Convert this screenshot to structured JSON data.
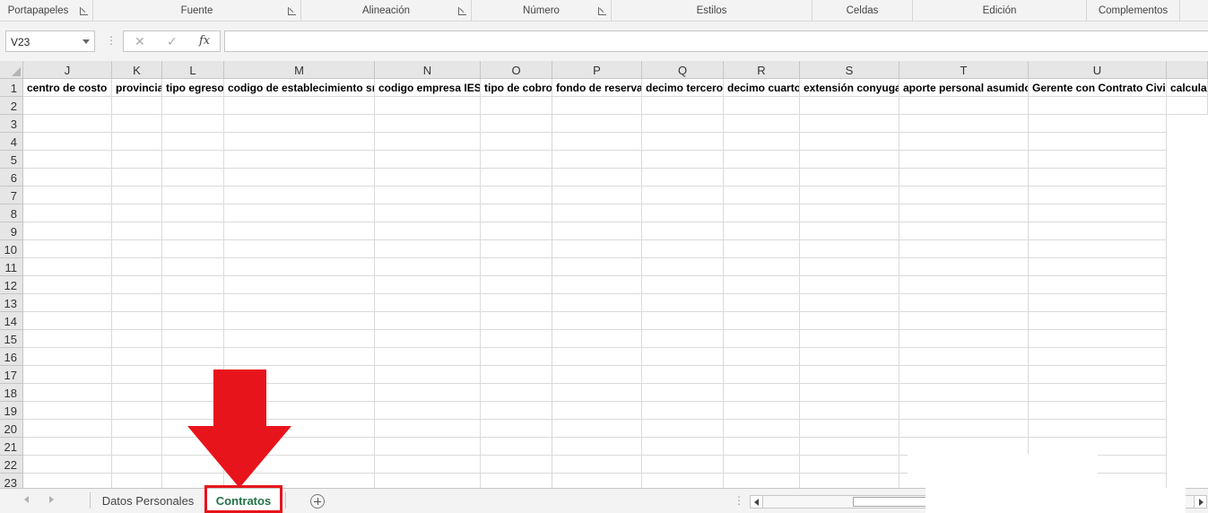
{
  "ribbon": {
    "groups": [
      {
        "label": "Portapapeles",
        "launcher": true
      },
      {
        "label": "Fuente",
        "launcher": true
      },
      {
        "label": "Alineación",
        "launcher": true
      },
      {
        "label": "Número",
        "launcher": true
      },
      {
        "label": "Estilos",
        "launcher": false
      },
      {
        "label": "Celdas",
        "launcher": false
      },
      {
        "label": "Edición",
        "launcher": false
      },
      {
        "label": "Complementos",
        "launcher": false
      }
    ]
  },
  "formula_bar": {
    "name_box": "V23",
    "cancel_icon": "✕",
    "enter_icon": "✓",
    "fx_icon": "fx",
    "value": ""
  },
  "grid": {
    "columns": [
      "J",
      "K",
      "L",
      "M",
      "N",
      "O",
      "P",
      "Q",
      "R",
      "S",
      "T",
      "U",
      ""
    ],
    "rows": [
      "1",
      "2",
      "3",
      "4",
      "5",
      "6",
      "7",
      "8",
      "9",
      "10",
      "11",
      "12",
      "13",
      "14",
      "15",
      "16",
      "17",
      "18",
      "19",
      "20",
      "21",
      "22",
      "23"
    ],
    "header_row": [
      "centro de costo",
      "provincia",
      "tipo egreso",
      "codigo de establecimiento sri",
      "codigo empresa IESS",
      "tipo de cobro",
      "fondo de reserva",
      "decimo tercero",
      "decimo cuarto",
      "extensión conyugal",
      "aporte personal asumido",
      "Gerente con Contrato Civil",
      "calcular"
    ]
  },
  "sheet_tabs": {
    "tabs": [
      {
        "label": "Datos Personales",
        "active": false
      },
      {
        "label": "Contratos",
        "active": true
      }
    ]
  },
  "colors": {
    "active_tab": "#217346",
    "annotation": "#e8141c"
  }
}
